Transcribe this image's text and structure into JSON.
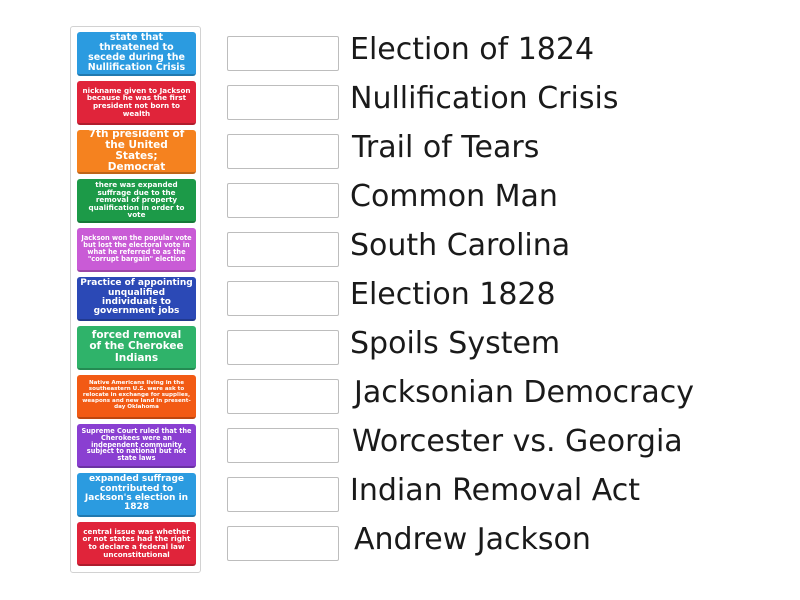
{
  "cards": [
    {
      "text": "state that threatened to secede during the Nullification Crisis",
      "color": "#2b9be0"
    },
    {
      "text": "nickname given to Jackson because he was the first president not born to wealth",
      "color": "#e0243a"
    },
    {
      "text": "7th president of the United States; Democrat",
      "color": "#f5821f"
    },
    {
      "text": "there was expanded suffrage due to the removal of property qualification in order to vote",
      "color": "#1c9a48"
    },
    {
      "text": "Jackson won the popular vote but lost the electoral vote in what he referred to as the \"corrupt bargain\" election",
      "color": "#c95bd6"
    },
    {
      "text": "Practice of appointing unqualified individuals to government jobs",
      "color": "#2b49b6"
    },
    {
      "text": "forced removal of the Cherokee Indians",
      "color": "#2fb36a"
    },
    {
      "text": "Native Americans living in the southeastern U.S. were ask to relocate in exchange for supplies, weapons and new land in present-day Oklahoma",
      "color": "#f25a14"
    },
    {
      "text": "Supreme Court ruled that the Cherokees were an independent community subject to national but not state laws",
      "color": "#8a3fd1"
    },
    {
      "text": "expanded suffrage contributed to Jackson's election in 1828",
      "color": "#2b9be0"
    },
    {
      "text": "central issue was whether or not states had the right to declare a federal law unconstitutional",
      "color": "#e0243a"
    }
  ],
  "terms": [
    "Election of 1824",
    "Nullification Crisis",
    "Trail of Tears",
    "Common Man",
    "South Carolina",
    "Election 1828",
    "Spoils System",
    "Jacksonian Democracy",
    "Worcester vs. Georgia",
    "Indian Removal Act",
    "Andrew Jackson"
  ]
}
